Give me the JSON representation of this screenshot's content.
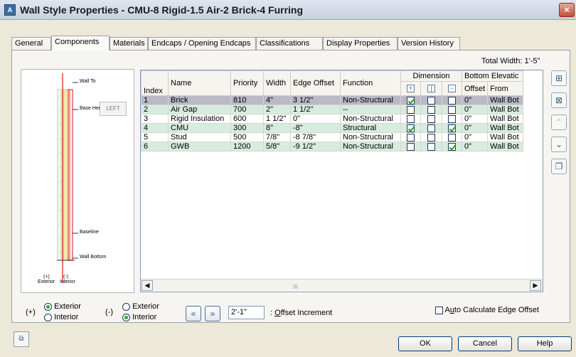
{
  "window": {
    "title": "Wall Style Properties - CMU-8 Rigid-1.5 Air-2 Brick-4 Furring",
    "app_icon": "autodesk-aca-icon",
    "close_glyph": "×"
  },
  "tabs": [
    {
      "label": "General"
    },
    {
      "label": "Components"
    },
    {
      "label": "Materials"
    },
    {
      "label": "Endcaps / Opening Endcaps"
    },
    {
      "label": "Classifications"
    },
    {
      "label": "Display Properties"
    },
    {
      "label": "Version History"
    }
  ],
  "active_tab": "Components",
  "total_width": "Total Width: 1'-5\"",
  "preview": {
    "left_label": "LEFT",
    "wall_top": "Wall To",
    "base_height": "Base Height",
    "baseline": "Baseline",
    "wall_bottom": "Wall Bottom",
    "exterior_sign": "(+)",
    "exterior": "Exterior",
    "interior_sign": "(-)",
    "interior": "Interior"
  },
  "grid": {
    "group_headers": {
      "dimension": "Dimension",
      "bottom_elevation": "Bottom Elevatic"
    },
    "headers": {
      "index": "Index",
      "name": "Name",
      "priority": "Priority",
      "width": "Width",
      "edge_offset": "Edge Offset",
      "function": "Function",
      "offset": "Offset",
      "from": "From"
    },
    "rows": [
      {
        "index": "1",
        "name": "Brick",
        "priority": "810",
        "width": "4\"",
        "edge_offset": "3 1/2\"",
        "function": "Non-Structural",
        "dim": [
          true,
          false,
          false
        ],
        "offset": "0\"",
        "from": "Wall Bot",
        "style": "sel"
      },
      {
        "index": "2",
        "name": "Air Gap",
        "priority": "700",
        "width": "2\"",
        "edge_offset": "1 1/2\"",
        "function": "--",
        "dim": [
          false,
          false,
          false
        ],
        "offset": "0\"",
        "from": "Wall Bot",
        "style": "odd"
      },
      {
        "index": "3",
        "name": "Rigid Insulation",
        "priority": "600",
        "width": "1 1/2\"",
        "edge_offset": "0\"",
        "function": "Non-Structural",
        "dim": [
          false,
          false,
          false
        ],
        "offset": "0\"",
        "from": "Wall Bot",
        "style": "even"
      },
      {
        "index": "4",
        "name": "CMU",
        "priority": "300",
        "width": "8\"",
        "edge_offset": "-8\"",
        "function": "Structural",
        "dim": [
          true,
          false,
          true
        ],
        "offset": "0\"",
        "from": "Wall Bot",
        "style": "odd"
      },
      {
        "index": "5",
        "name": "Stud",
        "priority": "500",
        "width": "7/8\"",
        "edge_offset": "-8 7/8\"",
        "function": "Non-Structural",
        "dim": [
          false,
          false,
          false
        ],
        "offset": "0\"",
        "from": "Wall Bot",
        "style": "even"
      },
      {
        "index": "6",
        "name": "GWB",
        "priority": "1200",
        "width": "5/8\"",
        "edge_offset": "-9 1/2\"",
        "function": "Non-Structural",
        "dim": [
          false,
          false,
          true
        ],
        "offset": "0\"",
        "from": "Wall Bot",
        "style": "odd"
      }
    ],
    "scroll_thumb": "III"
  },
  "controls": {
    "plus_sign": "(+)",
    "minus_sign": "(-)",
    "exterior": "Exterior",
    "interior": "Interior",
    "offset_value": "2'-1\"",
    "offset_label_pre": ": ",
    "offset_label_u": "O",
    "offset_label_post": "ffset Increment",
    "auto_calc_pre": "A",
    "auto_calc_u": "u",
    "auto_calc_post": "to Calculate Edge Offset"
  },
  "buttons": {
    "ok": "OK",
    "cancel": "Cancel",
    "help": "Help"
  },
  "colors": {
    "row_highlight": "#d6ecdf",
    "row_selected": "#b9b9c7",
    "check": "#21a121"
  }
}
